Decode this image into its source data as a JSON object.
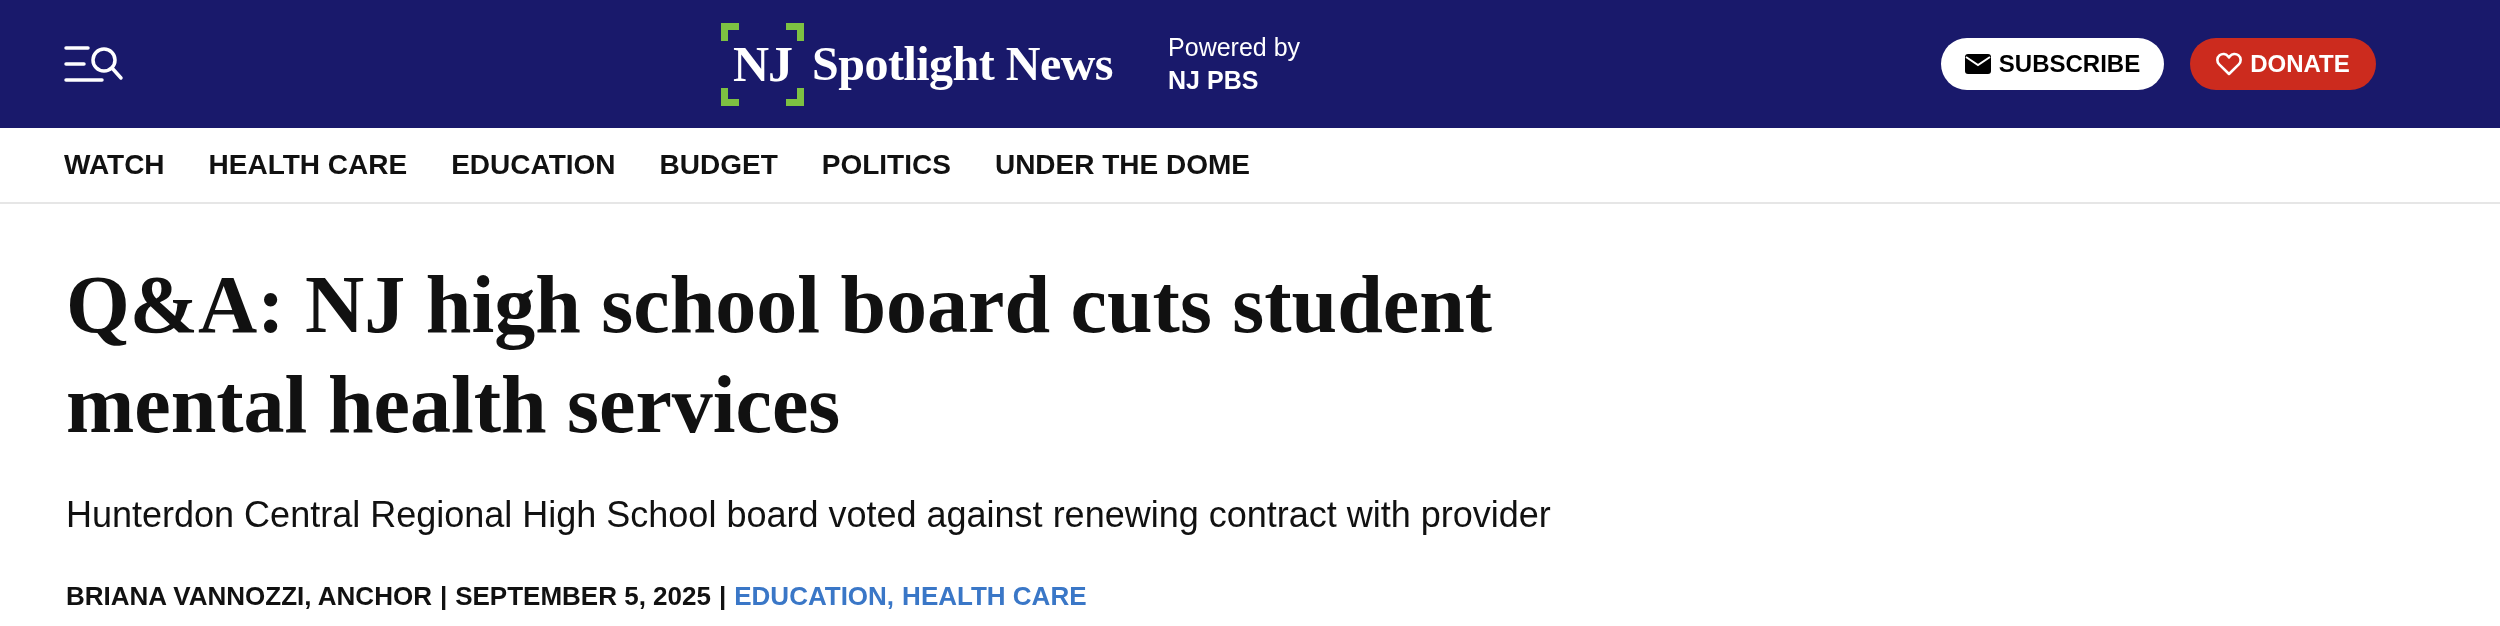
{
  "header": {
    "logo": {
      "mark": "NJ",
      "name": "Spotlight News"
    },
    "powered_by": {
      "label": "Powered by",
      "network": "NJ PBS"
    },
    "buttons": [
      {
        "kind": "subscribe",
        "label": "SUBSCRIBE"
      },
      {
        "kind": "donate",
        "label": "DONATE"
      }
    ]
  },
  "nav": {
    "items": [
      {
        "label": "WATCH"
      },
      {
        "label": "HEALTH CARE"
      },
      {
        "label": "EDUCATION"
      },
      {
        "label": "BUDGET"
      },
      {
        "label": "POLITICS"
      },
      {
        "label": "UNDER THE DOME"
      }
    ]
  },
  "article": {
    "title": "Q&A: NJ high school board cuts student mental health services",
    "subtitle": "Hunterdon Central Regional High School board voted against renewing contract with provider",
    "byline": {
      "author": "BRIANA VANNOZZI, ANCHOR",
      "separator_1": "|",
      "date": "SEPTEMBER 5, 2025",
      "separator_2": "|",
      "categories": [
        {
          "label": "EDUCATION,"
        },
        {
          "label": "HEALTH CARE"
        }
      ]
    }
  }
}
